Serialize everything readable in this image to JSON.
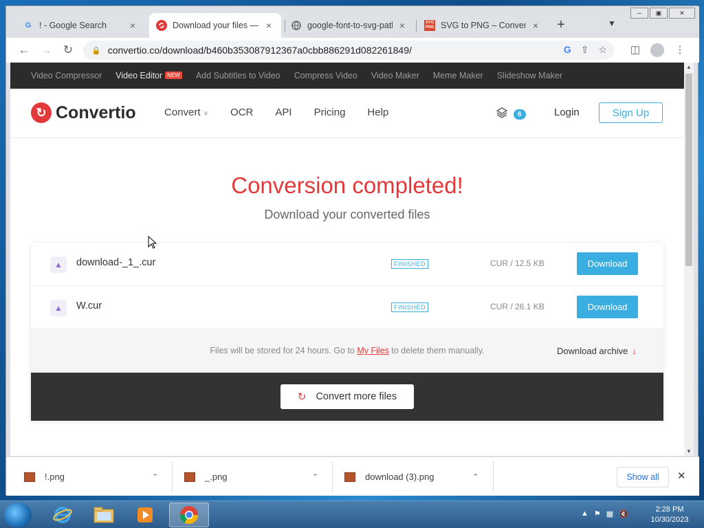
{
  "browser": {
    "tabs": [
      {
        "title": "! - Google Search",
        "icon": "google-g-icon",
        "active": false
      },
      {
        "title": "Download your files — Convertio",
        "icon": "convertio-icon",
        "active": true
      },
      {
        "title": "google-font-to-svg-path",
        "icon": "globe-icon",
        "active": false
      },
      {
        "title": "SVG to PNG – Convert",
        "icon": "svg-png-icon",
        "active": false
      }
    ],
    "url": "convertio.co/download/b460b353087912367a0cbb886291d082261849/"
  },
  "promo": {
    "items": [
      "Video Compressor",
      "Video Editor",
      "Add Subtitles to Video",
      "Compress Video",
      "Video Maker",
      "Meme Maker",
      "Slideshow Maker"
    ],
    "new_badge": "NEW"
  },
  "header": {
    "logo": "Convertio",
    "nav": [
      "Convert",
      "OCR",
      "API",
      "Pricing",
      "Help"
    ],
    "count": "6",
    "login": "Login",
    "signup": "Sign Up"
  },
  "main": {
    "title": "Conversion completed!",
    "subtitle": "Download your converted files",
    "files": [
      {
        "name": "download-_1_.cur",
        "status": "FINISHED",
        "size": "CUR / 12.5 KB",
        "button": "Download"
      },
      {
        "name": "W.cur",
        "status": "FINISHED",
        "size": "CUR / 26.1 KB",
        "button": "Download"
      }
    ],
    "info_prefix": "Files will be stored for 24 hours. Go to ",
    "info_link": "My Files",
    "info_suffix": " to delete them manually.",
    "archive": "Download archive",
    "convert_more": "Convert more files"
  },
  "downloads": {
    "items": [
      "!.png",
      "_.png",
      "download (3).png"
    ],
    "show_all": "Show all"
  },
  "taskbar": {
    "time": "2:28 PM",
    "date": "10/30/2023"
  },
  "colors": {
    "accent_red": "#e23a3a",
    "accent_blue": "#3aaee0"
  }
}
